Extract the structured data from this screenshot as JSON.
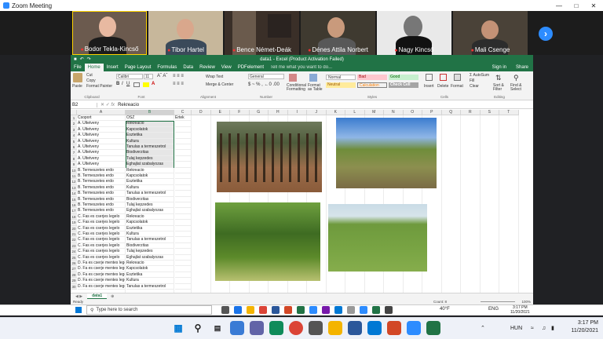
{
  "zoom": {
    "window_title": "Zoom Meeting",
    "participants": [
      {
        "name": "Bodor Tekla-Kincső"
      },
      {
        "name": "Tibor Hartel"
      },
      {
        "name": "Bence Német-Deák"
      },
      {
        "name": "Dénes Attila Norbert"
      },
      {
        "name": "Nagy Kincső"
      },
      {
        "name": "Mali Csenge"
      }
    ]
  },
  "excel": {
    "title": "data1 - Excel (Product Activation Failed)",
    "tabs": [
      "File",
      "Home",
      "Insert",
      "Page Layout",
      "Formulas",
      "Data",
      "Review",
      "View",
      "PDFelement"
    ],
    "tell_me": "Tell me what you want to do...",
    "sign_in": "Sign in",
    "share": "Share",
    "ribbon": {
      "paste": "Paste",
      "cut": "Cut",
      "copy": "Copy",
      "format_painter": "Format Painter",
      "clipboard": "Clipboard",
      "font_name": "Calibri",
      "font_size": "11",
      "font": "Font",
      "wrap_text": "Wrap Text",
      "merge_center": "Merge & Center",
      "alignment": "Alignment",
      "number_format": "General",
      "number": "Number",
      "conditional_formatting": "Conditional Formatting",
      "format_as_table": "Format as Table",
      "styles": "Styles",
      "style_normal": "Normal",
      "style_bad": "Bad",
      "style_good": "Good",
      "style_neutral": "Neutral",
      "style_calculation": "Calculation",
      "style_check_cell": "Check Cell",
      "insert": "Insert",
      "delete": "Delete",
      "format": "Format",
      "cells": "Cells",
      "autosum": "AutoSum",
      "fill": "Fill",
      "clear": "Clear",
      "sort_filter": "Sort & Filter",
      "find_select": "Find & Select",
      "editing": "Editing"
    },
    "name_box": "B2",
    "formula": "Rekreacio",
    "columns": [
      "A",
      "B",
      "C",
      "D",
      "E",
      "F",
      "G",
      "H",
      "I",
      "J",
      "K",
      "L",
      "M",
      "N",
      "O",
      "P",
      "Q",
      "R",
      "S",
      "T"
    ],
    "rows": [
      {
        "n": "1",
        "a": "Csoport",
        "b": "OSZ",
        "c": "Ertek"
      },
      {
        "n": "2",
        "a": "A. Ultetveny",
        "b": "Rekreacio",
        "c": ""
      },
      {
        "n": "3",
        "a": "A. Ultetveny",
        "b": "Kapcsolatok",
        "c": ""
      },
      {
        "n": "4",
        "a": "A. Ultetveny",
        "b": "Esztetika",
        "c": ""
      },
      {
        "n": "5",
        "a": "A. Ultetveny",
        "b": "Kultura",
        "c": ""
      },
      {
        "n": "6",
        "a": "A. Ultetveny",
        "b": "Tanulas a termeszetrol",
        "c": ""
      },
      {
        "n": "7",
        "a": "A. Ultetveny",
        "b": "Biodiverzitas",
        "c": ""
      },
      {
        "n": "8",
        "a": "A. Ultetveny",
        "b": "Tulaj kepzedes",
        "c": ""
      },
      {
        "n": "9",
        "a": "A. Ultetveny",
        "b": "Eghajlat szabalyozas",
        "c": ""
      },
      {
        "n": "10",
        "a": "B. Termeszetes erdo",
        "b": "Rekreacio",
        "c": ""
      },
      {
        "n": "11",
        "a": "B. Termeszetes erdo",
        "b": "Kapcsolatok",
        "c": ""
      },
      {
        "n": "12",
        "a": "B. Termeszetes erdo",
        "b": "Esztetika",
        "c": ""
      },
      {
        "n": "13",
        "a": "B. Termeszetes erdo",
        "b": "Kultura",
        "c": ""
      },
      {
        "n": "14",
        "a": "B. Termeszetes erdo",
        "b": "Tanulas a termeszetrol",
        "c": ""
      },
      {
        "n": "15",
        "a": "B. Termeszetes erdo",
        "b": "Biodiverzitas",
        "c": ""
      },
      {
        "n": "16",
        "a": "B. Termeszetes erdo",
        "b": "Tulaj kepzedes",
        "c": ""
      },
      {
        "n": "17",
        "a": "B. Termeszetes erdo",
        "b": "Eghajlat szabalyozas",
        "c": ""
      },
      {
        "n": "18",
        "a": "C. Fas es cserjes legelo",
        "b": "Rekreacio",
        "c": ""
      },
      {
        "n": "19",
        "a": "C. Fas es cserjes legelo",
        "b": "Kapcsolatok",
        "c": ""
      },
      {
        "n": "20",
        "a": "C. Fas es cserjes legelo",
        "b": "Esztetika",
        "c": ""
      },
      {
        "n": "21",
        "a": "C. Fas es cserjes legelo",
        "b": "Kultura",
        "c": ""
      },
      {
        "n": "22",
        "a": "C. Fas es cserjes legelo",
        "b": "Tanulas a termeszetrol",
        "c": ""
      },
      {
        "n": "23",
        "a": "C. Fas es cserjes legelo",
        "b": "Biodiverzitas",
        "c": ""
      },
      {
        "n": "24",
        "a": "C. Fas es cserjes legelo",
        "b": "Tulaj kepzedes",
        "c": ""
      },
      {
        "n": "25",
        "a": "C. Fas es cserjes legelo",
        "b": "Eghajlat szabalyozas",
        "c": ""
      },
      {
        "n": "26",
        "a": "D. Fa es cserje mentes legelo",
        "b": "Rekreacio",
        "c": ""
      },
      {
        "n": "27",
        "a": "D. Fa es cserje mentes legelo",
        "b": "Kapcsolatok",
        "c": ""
      },
      {
        "n": "28",
        "a": "D. Fa es cserje mentes legelo",
        "b": "Esztetika",
        "c": ""
      },
      {
        "n": "29",
        "a": "D. Fa es cserje mentes legelo",
        "b": "Kultura",
        "c": ""
      },
      {
        "n": "30",
        "a": "D. Fa es cserje mentes legelo",
        "b": "Tanulas a termeszetrol",
        "c": ""
      }
    ],
    "sheet_tab": "data1",
    "status_ready": "Ready",
    "status_count": "Count: 8",
    "zoom_level": "100%"
  },
  "windows": {
    "search_placeholder": "Type here to search",
    "weather": "40°F",
    "lang_small": "ENG",
    "time_small": "3:17 PM",
    "date_small": "11/20/2021",
    "lang": "HUN",
    "time": "3:17 PM",
    "date": "11/20/2021"
  }
}
